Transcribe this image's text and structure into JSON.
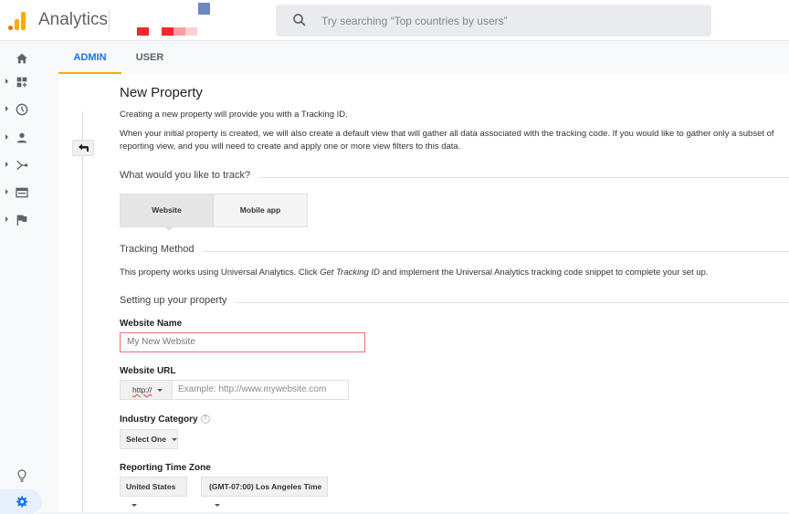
{
  "header": {
    "app_title": "Analytics",
    "search_placeholder": "Try searching “Top countries by users”",
    "logo_colors": [
      "#e37400",
      "#f9ab00",
      "#f9ab00"
    ]
  },
  "sidebar": {
    "items": [
      {
        "name": "home",
        "icon": "home-icon"
      },
      {
        "name": "customization",
        "icon": "dashboard-icon"
      },
      {
        "name": "realtime",
        "icon": "clock-icon"
      },
      {
        "name": "audience",
        "icon": "person-icon"
      },
      {
        "name": "acquisition",
        "icon": "acquisition-icon"
      },
      {
        "name": "behavior",
        "icon": "behavior-icon"
      },
      {
        "name": "conversions",
        "icon": "flag-icon"
      }
    ],
    "bottom": [
      {
        "name": "discover",
        "icon": "lightbulb-icon"
      },
      {
        "name": "admin",
        "icon": "gear-icon",
        "active": true
      }
    ]
  },
  "tabs": [
    {
      "label": "ADMIN",
      "active": true
    },
    {
      "label": "USER",
      "active": false
    }
  ],
  "main": {
    "title": "New Property",
    "intro": "Creating a new property will provide you with a Tracking ID.",
    "desc_line1": "When your initial property is created, we will also create a default view that will gather all data associated with the tracking code. If you would like to gather only a subset of",
    "desc_line2": "reporting view, and you will need to create and apply one or more view filters to this data.",
    "track_section": "What would you like to track?",
    "track_options": [
      {
        "label": "Website",
        "selected": true
      },
      {
        "label": "Mobile app",
        "selected": false
      }
    ],
    "method_section": "Tracking Method",
    "method_text_pre": "This property works using Universal Analytics. Click ",
    "method_text_em": "Get Tracking ID",
    "method_text_post": " and implement the Universal Analytics tracking code snippet to complete your set up.",
    "setup_section": "Setting up your property",
    "website_name_label": "Website Name",
    "website_name_placeholder": "My New Website",
    "website_url_label": "Website URL",
    "url_protocol": "http://",
    "website_url_placeholder": "Example: http://www.mywebsite.com",
    "industry_label": "Industry Category",
    "industry_help": "?",
    "industry_value": "Select One",
    "timezone_label": "Reporting Time Zone",
    "timezone_country": "United States",
    "timezone_value": "(GMT-07:00) Los Angeles Time"
  },
  "colors": {
    "accent": "#1a73e8",
    "tab_underline": "#f9ab00",
    "error_border": "#e57373"
  }
}
